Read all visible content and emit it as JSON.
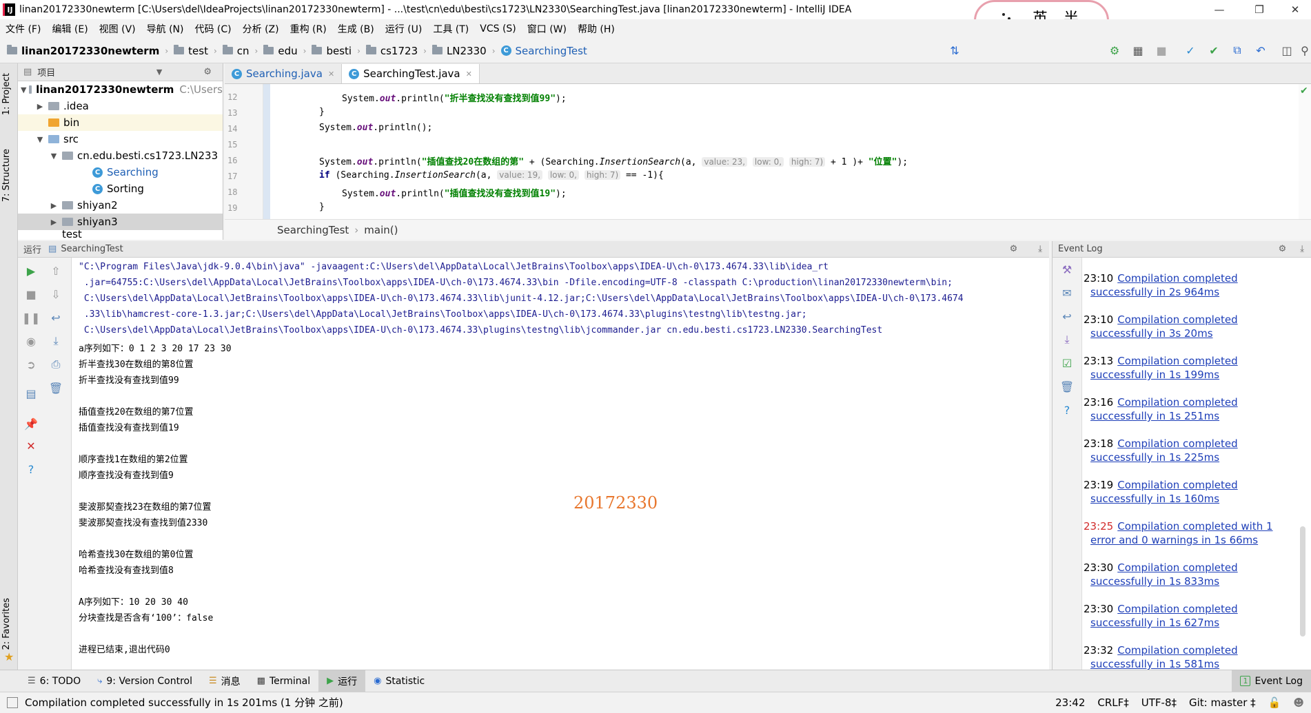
{
  "window": {
    "app_icon": "IJ",
    "title": "linan20172330newterm [C:\\Users\\del\\IdeaProjects\\linan20172330newterm] - ...\\test\\cn\\edu\\besti\\cs1723\\LN2330\\SearchingTest.java [linan20172330newterm] - IntelliJ IDEA"
  },
  "sticker": {
    "text": "英 半"
  },
  "menu": [
    "文件 (F)",
    "编辑 (E)",
    "视图 (V)",
    "导航 (N)",
    "代码 (C)",
    "分析 (Z)",
    "重构 (R)",
    "生成 (B)",
    "运行 (U)",
    "工具 (T)",
    "VCS (S)",
    "窗口 (W)",
    "帮助 (H)"
  ],
  "breadcrumbs": [
    "linan20172330newterm",
    "test",
    "cn",
    "edu",
    "besti",
    "cs1723",
    "LN2330",
    "SearchingTest"
  ],
  "side_tabs": {
    "project": "1: Project",
    "structure": "7: Structure",
    "favorites": "2: Favorites"
  },
  "project": {
    "header": "项目",
    "root_name": "linan20172330newterm",
    "root_path": "C:\\Users",
    "items": {
      "idea": ".idea",
      "bin": "bin",
      "src": "src",
      "pkg": "cn.edu.besti.cs1723.LN233",
      "searching": "Searching",
      "sorting": "Sorting",
      "shiyan2": "shiyan2",
      "shiyan3": "shiyan3",
      "test": "test"
    }
  },
  "editor": {
    "tabs": [
      "Searching.java",
      "SearchingTest.java"
    ],
    "line_numbers": [
      "12",
      "13",
      "14",
      "15",
      "16",
      "17",
      "18",
      "19"
    ],
    "code": {
      "l12_str": "\"折半查找没有查找到值99\"",
      "l16_str1": "\"插值查找20在数组的第\"",
      "l16_hint_value": "value: 23,",
      "l16_hint_low": "low: 0,",
      "l16_hint_high": "high: 7)",
      "l16_str2": "\"位置\"",
      "l17_hint_value": "value: 19,",
      "l17_hint_low": "low: 0,",
      "l17_hint_high": "high: 7)",
      "l18_str": "\"插值查找没有查找到值19\""
    },
    "crumbs": {
      "cls": "SearchingTest",
      "method": "main()"
    }
  },
  "run": {
    "header_label": "运行",
    "config": "SearchingTest",
    "cmd_lines": [
      "\"C:\\Program Files\\Java\\jdk-9.0.4\\bin\\java\" -javaagent:C:\\Users\\del\\AppData\\Local\\JetBrains\\Toolbox\\apps\\IDEA-U\\ch-0\\173.4674.33\\lib\\idea_rt",
      " .jar=64755:C:\\Users\\del\\AppData\\Local\\JetBrains\\Toolbox\\apps\\IDEA-U\\ch-0\\173.4674.33\\bin -Dfile.encoding=UTF-8 -classpath C:\\production\\linan20172330newterm\\bin;",
      " C:\\Users\\del\\AppData\\Local\\JetBrains\\Toolbox\\apps\\IDEA-U\\ch-0\\173.4674.33\\lib\\junit-4.12.jar;C:\\Users\\del\\AppData\\Local\\JetBrains\\Toolbox\\apps\\IDEA-U\\ch-0\\173.4674",
      " .33\\lib\\hamcrest-core-1.3.jar;C:\\Users\\del\\AppData\\Local\\JetBrains\\Toolbox\\apps\\IDEA-U\\ch-0\\173.4674.33\\plugins\\testng\\lib\\testng.jar;",
      " C:\\Users\\del\\AppData\\Local\\JetBrains\\Toolbox\\apps\\IDEA-U\\ch-0\\173.4674.33\\plugins\\testng\\lib\\jcommander.jar cn.edu.besti.cs1723.LN2330.SearchingTest"
    ],
    "output": [
      "a序列如下：0 1 2 3 20 17 23 30",
      "折半查找30在数组的第8位置",
      "折半查找没有查找到值99",
      "",
      "插值查找20在数组的第7位置",
      "插值查找没有查找到值19",
      "",
      "顺序查找1在数组的第2位置",
      "顺序查找没有查找到值9",
      "",
      "斐波那契查找23在数组的第7位置",
      "斐波那契查找没有查找到值2330",
      "",
      "哈希查找30在数组的第0位置",
      "哈希查找没有查找到值8",
      "",
      "A序列如下：10 20 30 40",
      "分块查找是否含有‘100’：false",
      "",
      "进程已结束,退出代码0"
    ],
    "watermark": "20172330"
  },
  "event_log": {
    "title": "Event Log",
    "entries": [
      {
        "time": "23:10",
        "line1": "Compilation completed",
        "line2": "successfully in 2s 964ms",
        "error": false
      },
      {
        "time": "23:10",
        "line1": "Compilation completed",
        "line2": "successfully in 3s 20ms",
        "error": false
      },
      {
        "time": "23:13",
        "line1": "Compilation completed",
        "line2": "successfully in 1s 199ms",
        "error": false
      },
      {
        "time": "23:16",
        "line1": "Compilation completed",
        "line2": "successfully in 1s 251ms",
        "error": false
      },
      {
        "time": "23:18",
        "line1": "Compilation completed",
        "line2": "successfully in 1s 225ms",
        "error": false
      },
      {
        "time": "23:19",
        "line1": "Compilation completed",
        "line2": "successfully in 1s 160ms",
        "error": false
      },
      {
        "time": "23:25",
        "line1": "Compilation completed with 1",
        "line2": "error and 0 warnings in 1s 66ms",
        "error": true
      },
      {
        "time": "23:30",
        "line1": "Compilation completed",
        "line2": "successfully in 1s 833ms",
        "error": false
      },
      {
        "time": "23:30",
        "line1": "Compilation completed",
        "line2": "successfully in 1s 627ms",
        "error": false
      },
      {
        "time": "23:32",
        "line1": "Compilation completed",
        "line2": "successfully in 1s 581ms",
        "error": false
      }
    ]
  },
  "bottom_tabs": {
    "todo": "6: TODO",
    "vcs": "9: Version Control",
    "messages": "消息",
    "terminal": "Terminal",
    "run": "运行",
    "statistic": "Statistic",
    "event_log_badge": "1",
    "event_log": "Event Log"
  },
  "status": {
    "message": "Compilation completed successfully in 1s 201ms (1 分钟 之前)",
    "time": "23:42",
    "line_sep": "CRLF‡",
    "encoding": "UTF-8‡",
    "git": "Git: master ‡"
  },
  "colors": {
    "accent": "#3d9ad8",
    "string": "#008000",
    "keyword": "#000080",
    "link": "#1e3fb8",
    "error": "#d12b2b",
    "watermark": "#e8772e"
  }
}
